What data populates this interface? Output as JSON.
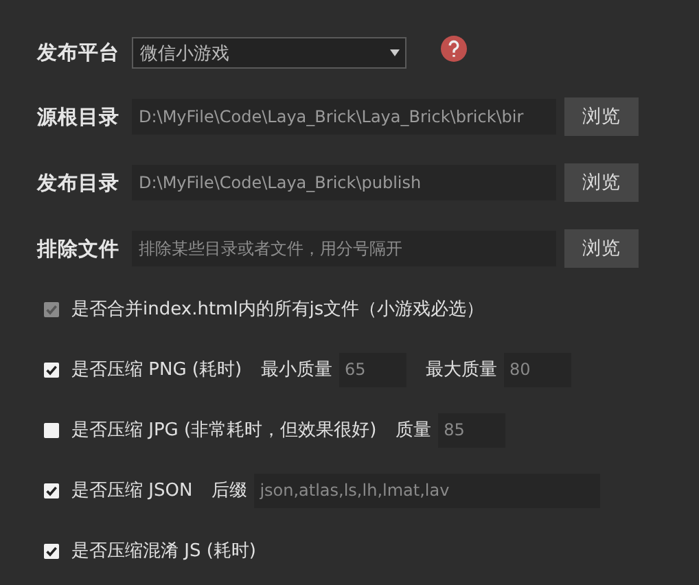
{
  "platform": {
    "label": "发布平台",
    "value": "微信小游戏"
  },
  "paths": [
    {
      "label": "源根目录",
      "value": "D:\\MyFile\\Code\\Laya_Brick\\Laya_Brick\\brick\\bir",
      "button": "浏览"
    },
    {
      "label": "发布目录",
      "value": "D:\\MyFile\\Code\\Laya_Brick\\publish",
      "button": "浏览"
    },
    {
      "label": "排除文件",
      "placeholder": "排除某些目录或者文件，用分号隔开",
      "button": "浏览"
    }
  ],
  "options": [
    {
      "label": "是否合并index.html内的所有js文件（小游戏必选）",
      "checked": true,
      "disabled": true
    },
    {
      "label": "是否压缩 PNG (耗时)",
      "checked": true,
      "disabled": false,
      "fields": [
        {
          "label": "最小质量",
          "value": "65",
          "kind": "number"
        },
        {
          "label": "最大质量",
          "value": "80",
          "kind": "number"
        }
      ]
    },
    {
      "label": "是否压缩 JPG (非常耗时，但效果很好)",
      "checked": false,
      "disabled": false,
      "fields": [
        {
          "label": "质量",
          "value": "85",
          "kind": "number"
        }
      ]
    },
    {
      "label": "是否压缩 JSON",
      "checked": true,
      "disabled": false,
      "fields": [
        {
          "label": "后缀",
          "value": "json,atlas,ls,lh,lmat,lav",
          "kind": "text"
        }
      ]
    },
    {
      "label": "是否压缩混淆 JS (耗时)",
      "checked": true,
      "disabled": false
    }
  ]
}
